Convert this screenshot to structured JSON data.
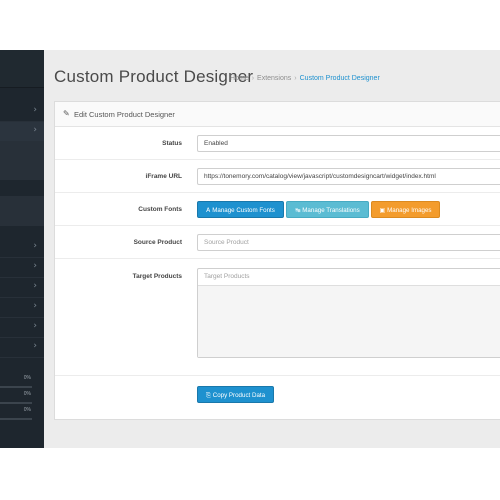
{
  "header": {
    "title": "Custom Product Designer",
    "breadcrumb": [
      "Home",
      "Extensions",
      "Custom Product Designer"
    ],
    "breadcrumb_separator": "›"
  },
  "panel": {
    "title": "Edit Custom Product Designer",
    "pencil_icon": "pencil-icon"
  },
  "form": {
    "status": {
      "label": "Status",
      "value": "Enabled"
    },
    "iframe_url": {
      "label": "iFrame URL",
      "value": "https://tonemory.com/catalog/view/javascript/customdesigncart/widget/index.html"
    },
    "custom_fonts": {
      "label": "Custom Fonts",
      "buttons": [
        {
          "icon": "A",
          "label": "Manage Custom Fonts",
          "color": "#1e91cf"
        },
        {
          "icon": "↹",
          "label": "Manage Translations",
          "color": "#5bbcd3"
        },
        {
          "icon": "▣",
          "label": "Manage Images",
          "color": "#f39c2d"
        }
      ]
    },
    "source_product": {
      "label": "Source Product",
      "placeholder": "Source Product"
    },
    "target_products": {
      "label": "Target Products",
      "placeholder": "Target Products"
    },
    "copy_button": {
      "icon": "⎘",
      "label": "Copy Product Data"
    }
  },
  "sidebar": {
    "chevron": "›",
    "stats": [
      {
        "label": "0%",
        "progress": 0
      },
      {
        "label": "0%",
        "progress": 0
      },
      {
        "label": "0%",
        "progress": 0
      }
    ]
  },
  "colors": {
    "accent": "#1e91cf",
    "info": "#5bbcd3",
    "warning": "#f39c2d",
    "sidebar_bg": "#1e262e"
  }
}
